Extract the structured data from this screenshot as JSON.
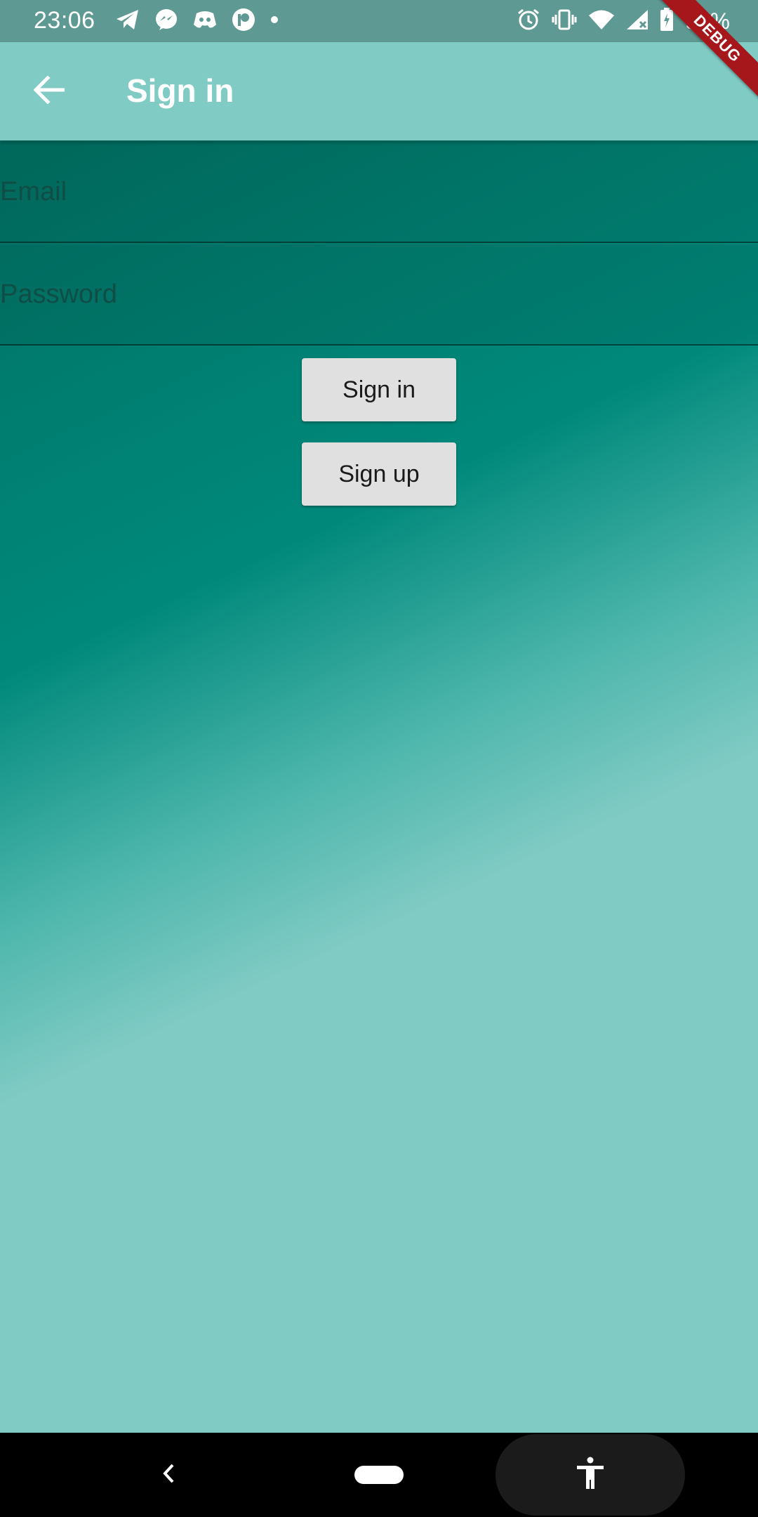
{
  "status_bar": {
    "time": "23:06",
    "battery_text": "97%",
    "left_icons": [
      "telegram-icon",
      "messenger-icon",
      "discord-icon",
      "patreon-icon",
      "dot-icon"
    ],
    "right_icons": [
      "alarm-icon",
      "vibrate-icon",
      "wifi-icon",
      "signal-icon",
      "battery-icon"
    ]
  },
  "debug_banner": "DEBUG",
  "app_bar": {
    "title": "Sign in",
    "back_icon": "arrow-back-icon"
  },
  "form": {
    "email": {
      "placeholder": "Email",
      "value": ""
    },
    "password": {
      "placeholder": "Password",
      "value": ""
    },
    "sign_in_label": "Sign in",
    "sign_up_label": "Sign up"
  },
  "nav_bar": {
    "back_icon": "chevron-left-icon",
    "home_icon": "home-pill-icon",
    "accessibility_icon": "accessibility-icon"
  },
  "colors": {
    "app_bar": "#80cbc4",
    "gradient_dark": "#00695c",
    "gradient_mid": "#00897b",
    "gradient_light": "#80cbc4",
    "button": "#e0e0e0",
    "debug_ribbon": "#a6171c"
  }
}
